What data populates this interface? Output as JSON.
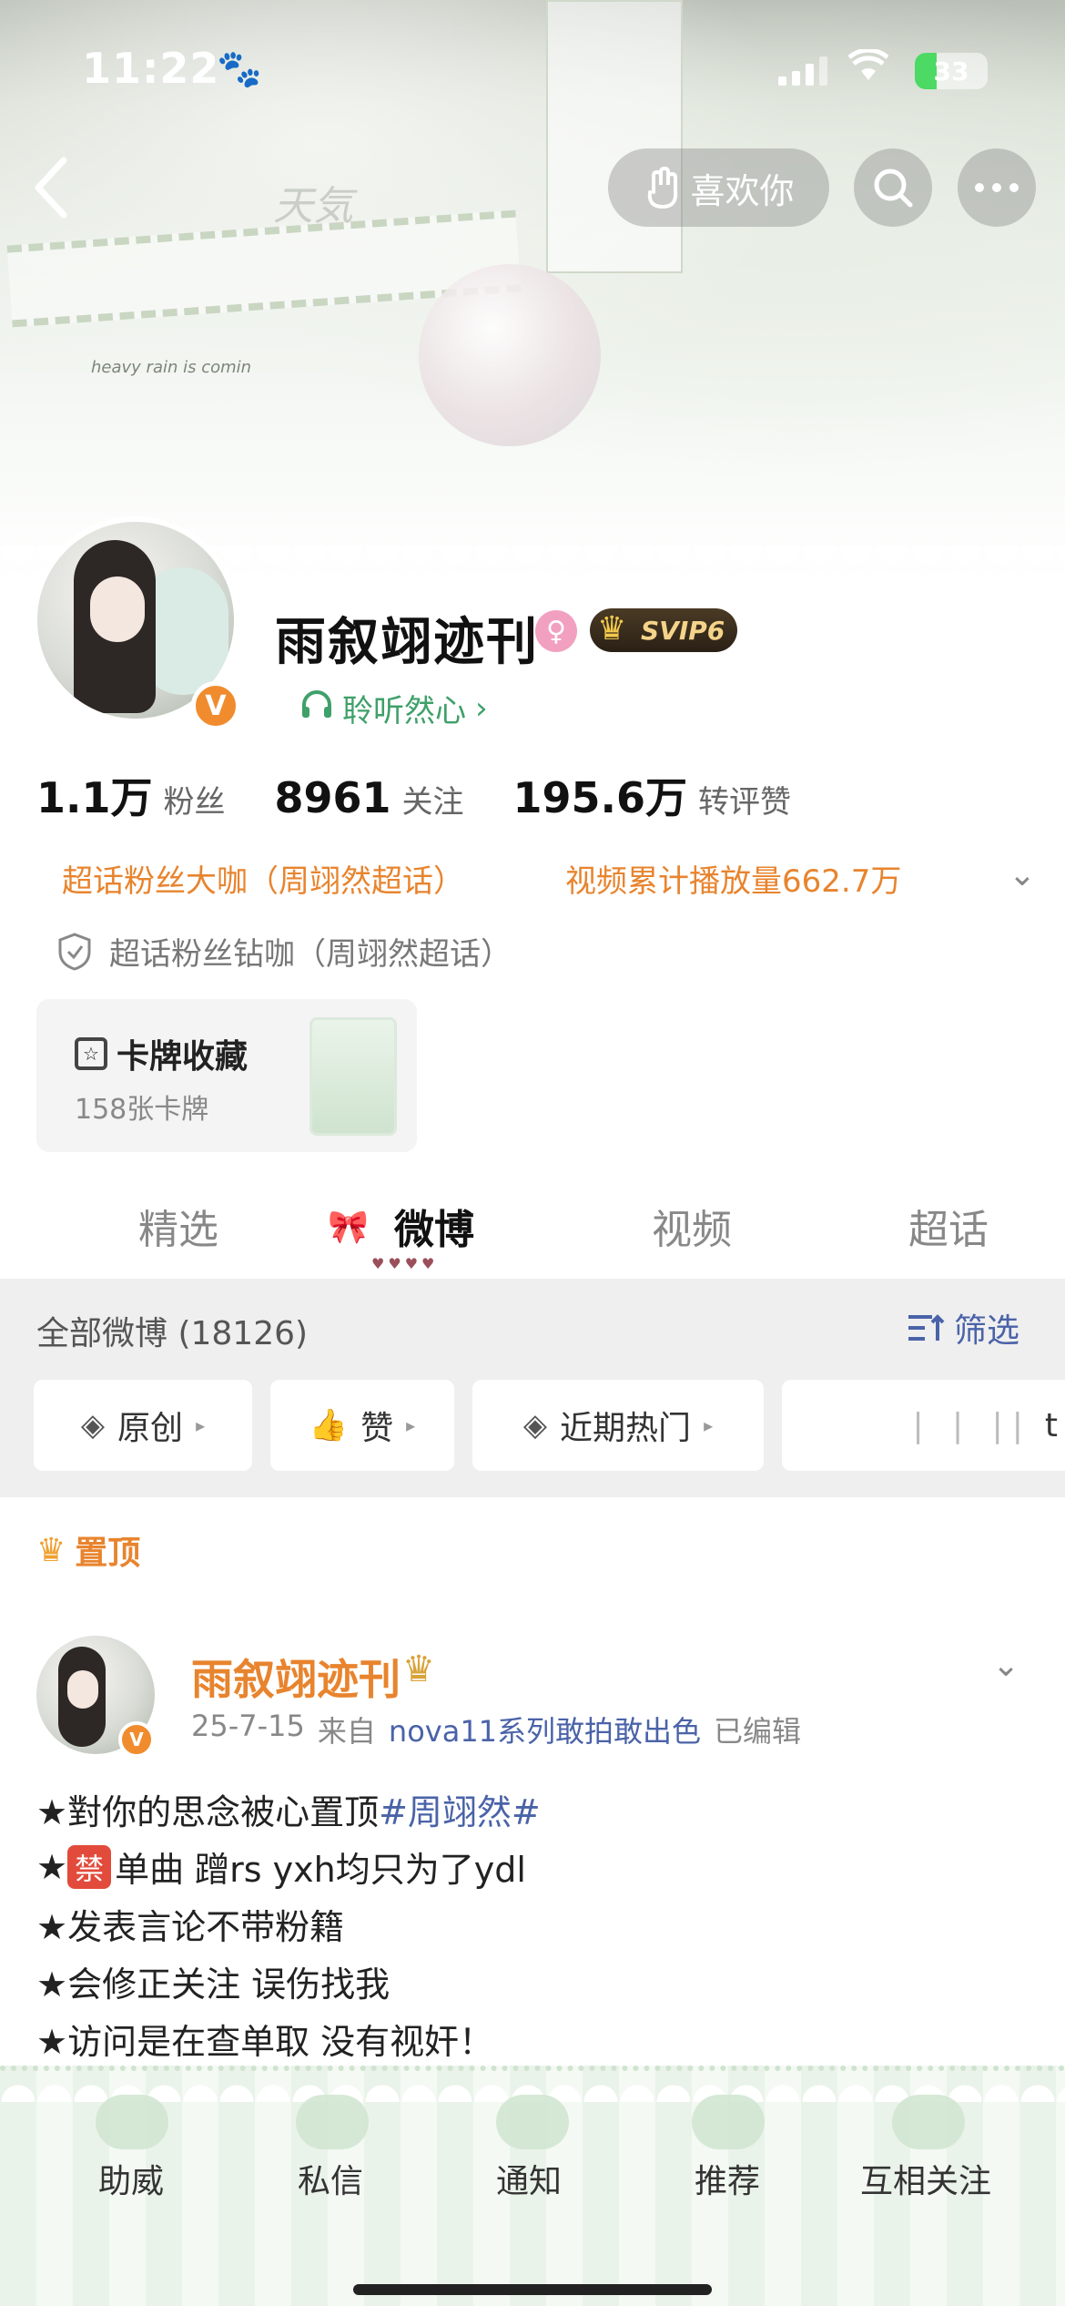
{
  "status_bar": {
    "time": "11:22",
    "battery": "33"
  },
  "top_nav": {
    "like_label": "喜欢你"
  },
  "banner": {
    "deco_title": "天気",
    "deco_subtitle": "heavy rain is comin"
  },
  "profile": {
    "name": "雨叙翊迹刊",
    "svip_label": "SVIP6",
    "verified_mark": "V",
    "listening": "聆听然心",
    "stats": [
      {
        "num": "1.1万",
        "label": "粉丝"
      },
      {
        "num": "8961",
        "label": "关注"
      },
      {
        "num": "195.6万",
        "label": "转评赞"
      }
    ],
    "honor_1": "超话粉丝大咖（周翊然超话）",
    "honor_2": "视频累计播放量662.7万",
    "honor_3": "超话粉丝钻咖（周翊然超话）",
    "card_title": "卡牌收藏",
    "card_count": "158张卡牌"
  },
  "tabs": [
    {
      "label": "精选"
    },
    {
      "label": "微博"
    },
    {
      "label": "视频"
    },
    {
      "label": "超话"
    }
  ],
  "feed": {
    "title": "全部微博 (18126)",
    "filter_label": "筛选",
    "chips": [
      {
        "label": "原创"
      },
      {
        "label": "赞"
      },
      {
        "label": "近期热门"
      },
      {
        "label": "t"
      }
    ],
    "pinned_label": "置顶"
  },
  "post": {
    "author": "雨叙翊迹刊",
    "date": "25-7-15",
    "from_label": "来自",
    "device": "nova11系列敢拍敢出色",
    "edited": "已编辑",
    "line1_text": "★對你的思念被心置顶",
    "line1_tag": "#周翊然#",
    "line2_badge": "禁",
    "line2_text": "单曲 蹭rs yxh均只为了ydl",
    "line3": "★发表言论不带粉籍",
    "line4": "★会修正关注 误伤找我",
    "line5": "★访问是在查单取 没有视奸！"
  },
  "bottom_nav": [
    {
      "label": "助威"
    },
    {
      "label": "私信"
    },
    {
      "label": "通知"
    },
    {
      "label": "推荐"
    },
    {
      "label": "互相关注"
    }
  ],
  "colors": {
    "accent_orange": "#e8842e",
    "link_blue": "#4a63a8",
    "green": "#3fa06a"
  }
}
